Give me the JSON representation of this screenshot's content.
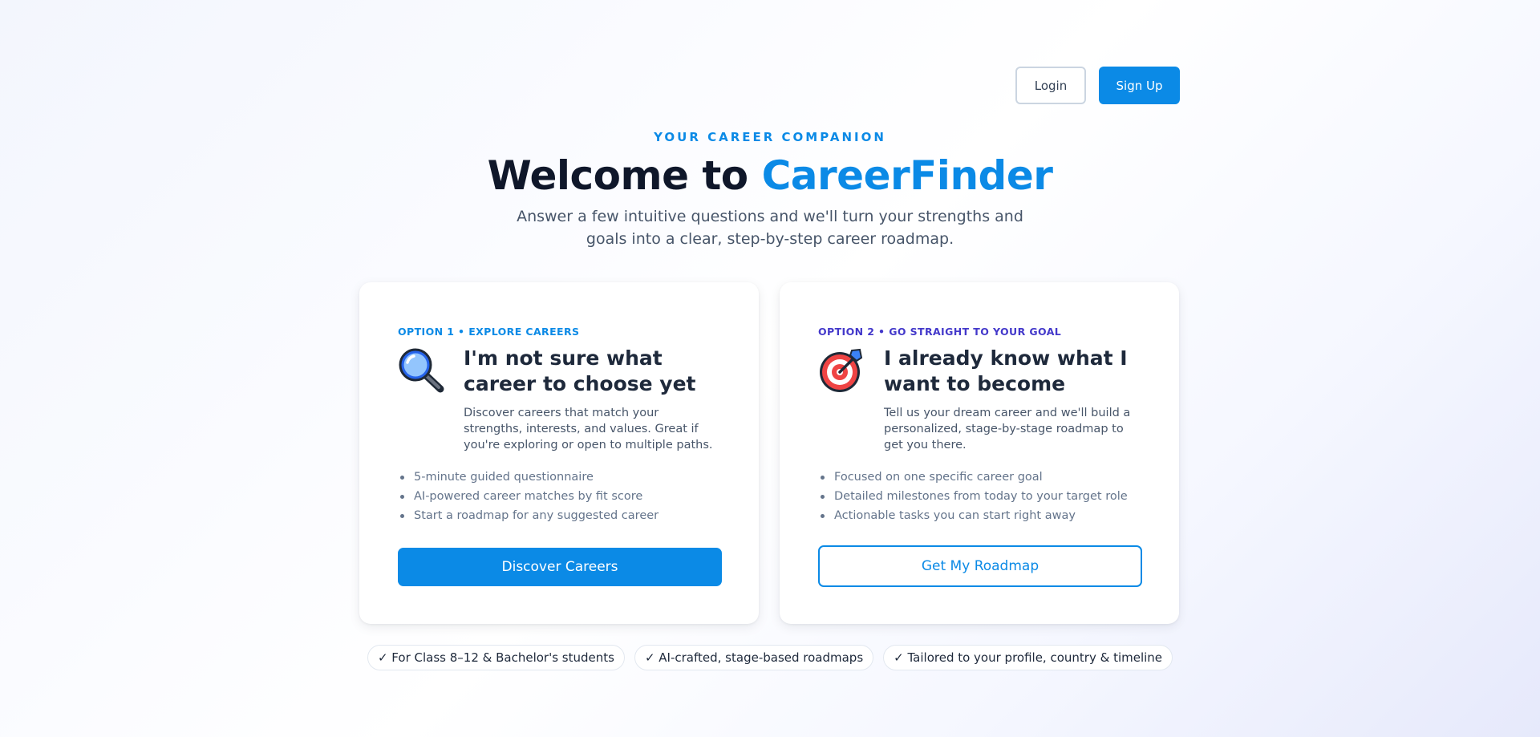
{
  "header": {
    "login_label": "Login",
    "signup_label": "Sign Up"
  },
  "hero": {
    "eyebrow": "YOUR CAREER COMPANION",
    "title_prefix": "Welcome to ",
    "title_brand": "CareerFinder",
    "subtitle": "Answer a few intuitive questions and we'll turn your strengths and goals into a clear, step-by-step career roadmap."
  },
  "cards": [
    {
      "option_label": "OPTION 1 • EXPLORE CAREERS",
      "icon": "magnifying-glass-icon",
      "title": "I'm not sure what career to choose yet",
      "description": "Discover careers that match your strengths, interests, and values. Great if you're exploring or open to multiple paths.",
      "features": [
        "5-minute guided questionnaire",
        "AI-powered career matches by fit score",
        "Start a roadmap for any suggested career"
      ],
      "button_label": "Discover Careers"
    },
    {
      "option_label": "OPTION 2 • GO STRAIGHT TO YOUR GOAL",
      "icon": "target-icon",
      "title": "I already know what I want to become",
      "description": "Tell us your dream career and we'll build a personalized, stage-by-stage roadmap to get you there.",
      "features": [
        "Focused on one specific career goal",
        "Detailed milestones from today to your target role",
        "Actionable tasks you can start right away"
      ],
      "button_label": "Get My Roadmap"
    }
  ],
  "badges": [
    "✓ For Class 8–12 & Bachelor's students",
    "✓ AI-crafted, stage-based roadmaps",
    "✓ Tailored to your profile, country & timeline"
  ],
  "colors": {
    "brand": "#0b8ae6",
    "option2_label": "#4338ca",
    "heading": "#0f172a"
  }
}
